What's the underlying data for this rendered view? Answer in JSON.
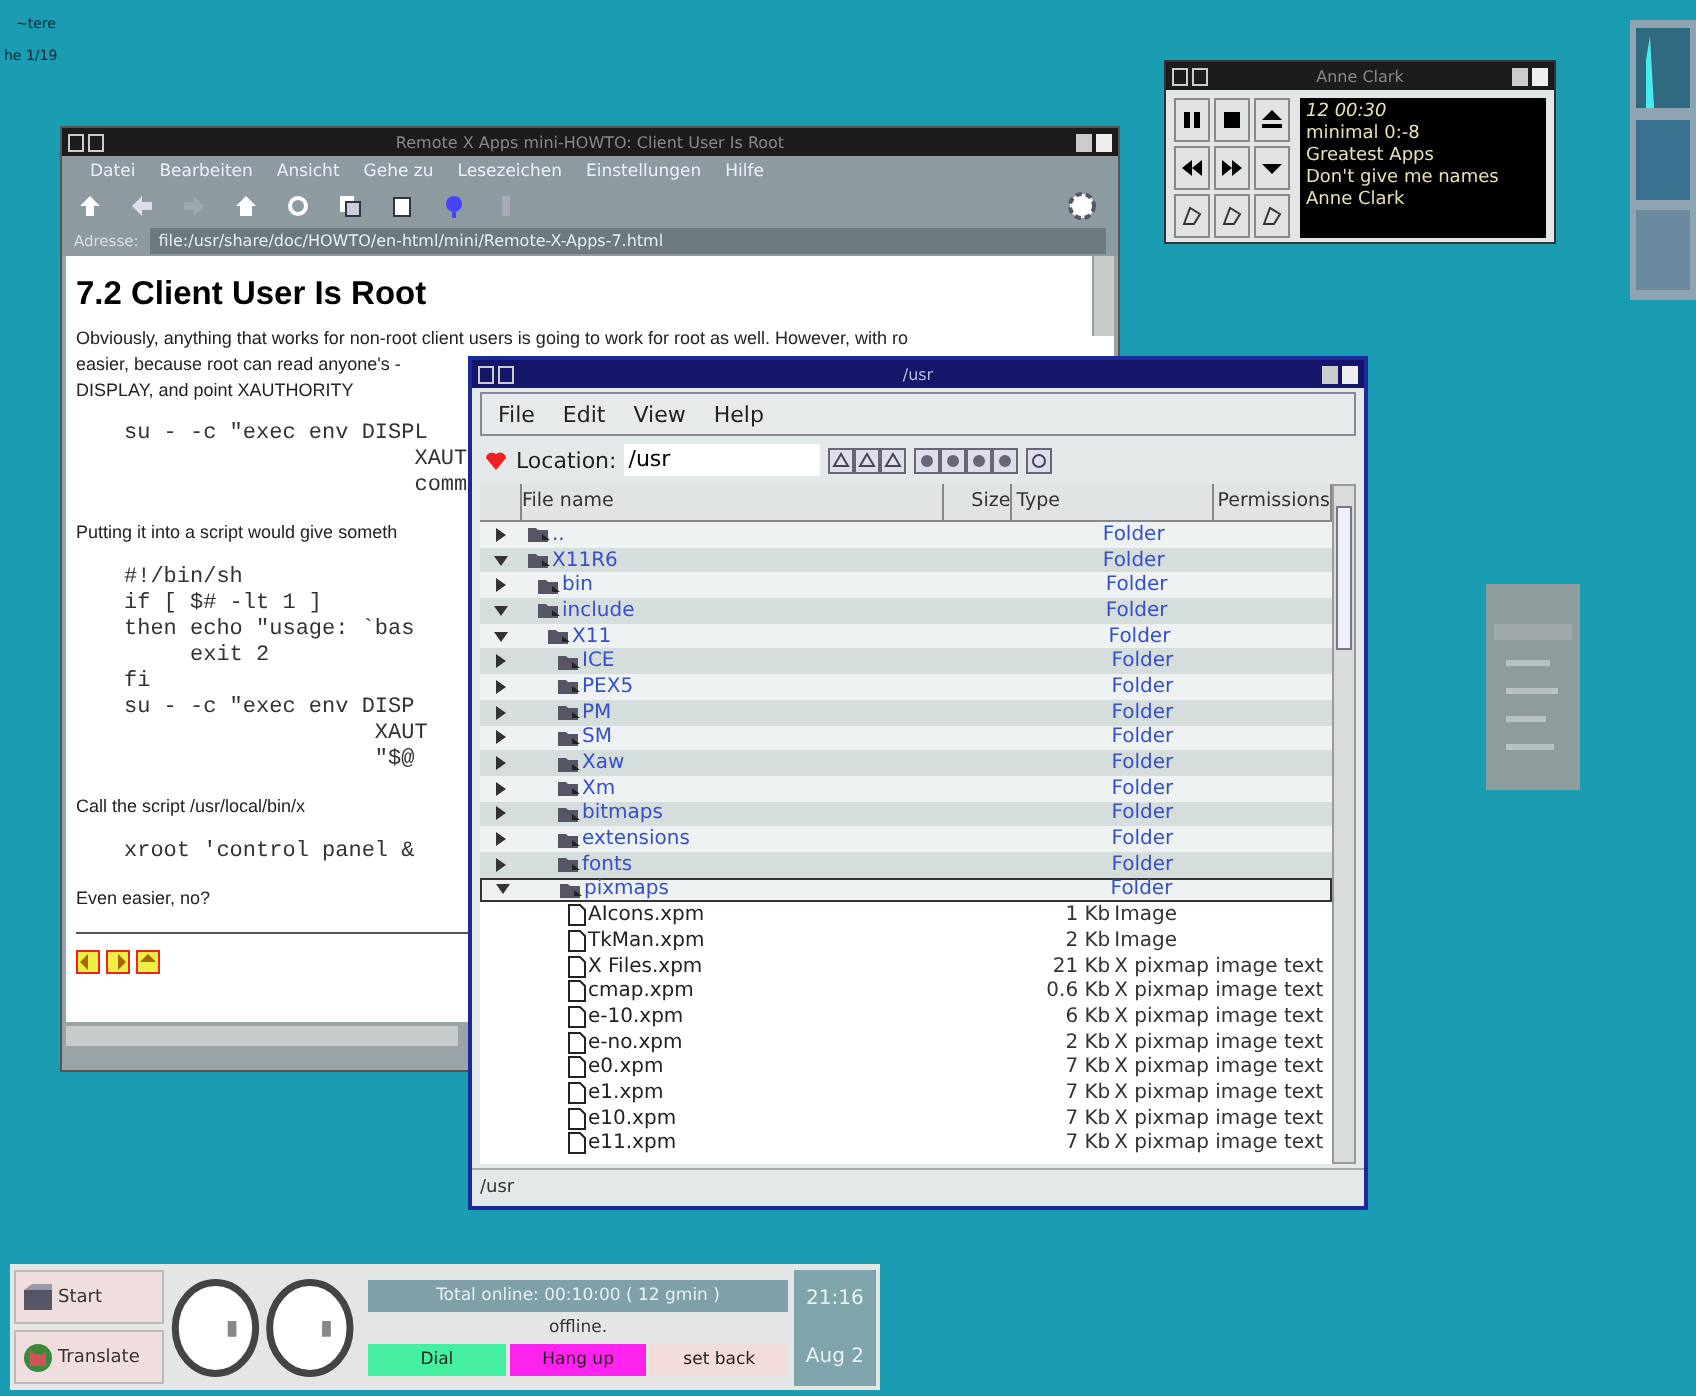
{
  "desktop": {
    "labels": [
      "~tere",
      "he 1/19"
    ]
  },
  "browser": {
    "title": "Remote X Apps mini-HOWTO: Client User Is Root",
    "menu": [
      "Datei",
      "Bearbeiten",
      "Ansicht",
      "Gehe zu",
      "Lesezeichen",
      "Einstellungen",
      "Hilfe"
    ],
    "location_label": "Adresse:",
    "location": "file:/usr/share/doc/HOWTO/en-html/mini/Remote-X-Apps-7.html",
    "content": [
      {
        "kind": "heading",
        "lines": [
          "7.2 Client User Is Root"
        ]
      },
      {
        "kind": "para",
        "lines": [
          "Obviously, anything that works for non-root client users is going to work for root as well. However, with ro",
          "easier, because root can read anyone's -",
          "DISPLAY, and point XAUTHORITY"
        ]
      },
      {
        "kind": "code",
        "lines": [
          "su - -c \"exec env DISPL",
          "                      XAUT",
          "                      comm"
        ]
      },
      {
        "kind": "para",
        "lines": [
          "Putting it into a script would give someth"
        ]
      },
      {
        "kind": "code",
        "lines": [
          "#!/bin/sh",
          "if [ $# -lt 1 ]",
          "then echo \"usage: `bas",
          "     exit 2",
          "fi",
          "su - -c \"exec env DISP",
          "                   XAUT",
          "                   \"$@"
        ]
      },
      {
        "kind": "para",
        "lines": [
          "Call the script /usr/local/bin/x"
        ]
      },
      {
        "kind": "code",
        "lines": [
          "xroot 'control panel &"
        ]
      },
      {
        "kind": "para",
        "lines": [
          "Even easier, no?"
        ]
      }
    ]
  },
  "file_manager": {
    "title": "/usr",
    "menu": [
      "File",
      "Edit",
      "View",
      "Help"
    ],
    "location_label": "Location:",
    "location": "/usr",
    "columns": [
      "File name",
      "Size",
      "Type",
      "Permissions"
    ],
    "tree": [
      {
        "name": "..",
        "kind": "folder",
        "type": "Folder",
        "expanded": false,
        "selected": false
      },
      {
        "name": "X11R6",
        "kind": "folder",
        "type": "Folder",
        "expanded": true,
        "selected": false,
        "children": [
          {
            "name": "bin",
            "kind": "folder",
            "type": "Folder",
            "expanded": false,
            "selected": false
          },
          {
            "name": "include",
            "kind": "folder",
            "type": "Folder",
            "expanded": true,
            "selected": false,
            "children": [
              {
                "name": "X11",
                "kind": "folder",
                "type": "Folder",
                "expanded": true,
                "selected": false,
                "children": [
                  {
                    "name": "ICE",
                    "kind": "folder",
                    "type": "Folder",
                    "expanded": false,
                    "selected": false
                  },
                  {
                    "name": "PEX5",
                    "kind": "folder",
                    "type": "Folder",
                    "expanded": false,
                    "selected": false
                  },
                  {
                    "name": "PM",
                    "kind": "folder",
                    "type": "Folder",
                    "expanded": false,
                    "selected": false
                  },
                  {
                    "name": "SM",
                    "kind": "folder",
                    "type": "Folder",
                    "expanded": false,
                    "selected": false
                  },
                  {
                    "name": "Xaw",
                    "kind": "folder",
                    "type": "Folder",
                    "expanded": false,
                    "selected": false
                  },
                  {
                    "name": "Xm",
                    "kind": "folder",
                    "type": "Folder",
                    "expanded": false,
                    "selected": false
                  },
                  {
                    "name": "bitmaps",
                    "kind": "folder",
                    "type": "Folder",
                    "expanded": false,
                    "selected": false
                  },
                  {
                    "name": "extensions",
                    "kind": "folder",
                    "type": "Folder",
                    "expanded": false,
                    "selected": false
                  },
                  {
                    "name": "fonts",
                    "kind": "folder",
                    "type": "Folder",
                    "expanded": false,
                    "selected": false
                  },
                  {
                    "name": "pixmaps",
                    "kind": "folder",
                    "type": "Folder",
                    "expanded": true,
                    "selected": true,
                    "children": [
                      {
                        "name": "AIcons.xpm",
                        "kind": "file",
                        "size": "1 Kb",
                        "type": "Image",
                        "selected": false
                      },
                      {
                        "name": "TkMan.xpm",
                        "kind": "file",
                        "size": "2 Kb",
                        "type": "Image",
                        "selected": false
                      },
                      {
                        "name": "X Files.xpm",
                        "kind": "file",
                        "size": "21 Kb",
                        "type": "X pixmap image text",
                        "selected": false
                      },
                      {
                        "name": "cmap.xpm",
                        "kind": "file",
                        "size": "0.6 Kb",
                        "type": "X pixmap image text",
                        "selected": false
                      },
                      {
                        "name": "e-10.xpm",
                        "kind": "file",
                        "size": "6 Kb",
                        "type": "X pixmap image text",
                        "selected": false
                      },
                      {
                        "name": "e-no.xpm",
                        "kind": "file",
                        "size": "2 Kb",
                        "type": "X pixmap image text",
                        "selected": false
                      },
                      {
                        "name": "e0.xpm",
                        "kind": "file",
                        "size": "7 Kb",
                        "type": "X pixmap image text",
                        "selected": false
                      },
                      {
                        "name": "e1.xpm",
                        "kind": "file",
                        "size": "7 Kb",
                        "type": "X pixmap image text",
                        "selected": false
                      },
                      {
                        "name": "e10.xpm",
                        "kind": "file",
                        "size": "7 Kb",
                        "type": "X pixmap image text",
                        "selected": false
                      },
                      {
                        "name": "e11.xpm",
                        "kind": "file",
                        "size": "7 Kb",
                        "type": "X pixmap image text",
                        "selected": false
                      }
                    ]
                  }
                ]
              }
            ]
          }
        ]
      }
    ],
    "status": "/usr"
  },
  "player": {
    "title": "Anne Clark",
    "display": [
      "12    00:30",
      "minimal 0:-8",
      "Greatest Apps",
      "Don't give me names",
      "Anne Clark"
    ]
  },
  "taskbar": {
    "buttons": [
      "Start",
      "Translate"
    ],
    "online": "Total online: 00:10:00 ( 12 gmin )",
    "status": "offline.",
    "actions": [
      {
        "label": "Dial",
        "color": "#44f0a0"
      },
      {
        "label": "Hang up",
        "color": "#ff22ee"
      },
      {
        "label": "set back",
        "color": "#f2dcdc"
      }
    ],
    "time": "21:16",
    "date": "Aug 2"
  }
}
